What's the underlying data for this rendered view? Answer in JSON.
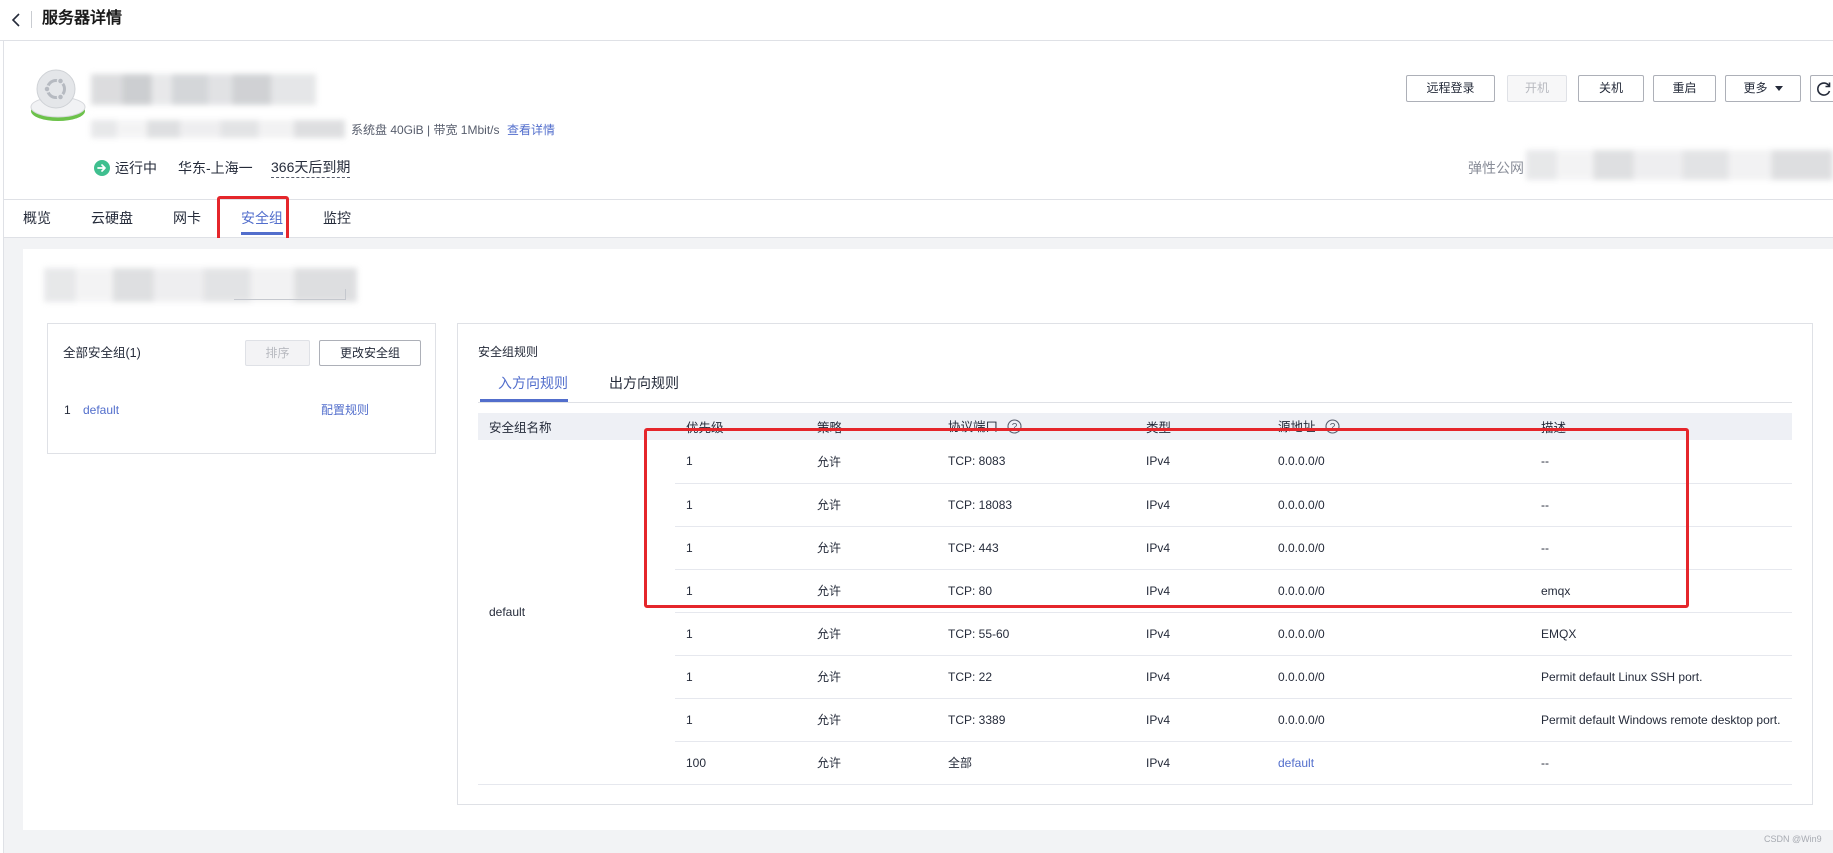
{
  "header": {
    "title": "服务器详情"
  },
  "server": {
    "specs": "系统盘 40GiB | 带宽 1Mbit/s",
    "details_link": "查看详情",
    "status": "运行中",
    "region": "华东-上海一",
    "expiry": "366天后到期",
    "eip_label": "弹性公网"
  },
  "actions": {
    "remote_login": "远程登录",
    "power_on": "开机",
    "power_off": "关机",
    "restart": "重启",
    "more": "更多"
  },
  "tabs": {
    "items": [
      "概览",
      "云硬盘",
      "网卡",
      "安全组",
      "监控"
    ],
    "active_index": 3
  },
  "security_groups": {
    "title": "全部安全组(1)",
    "sort_button": "排序",
    "change_button": "更改安全组",
    "items": [
      {
        "index": "1",
        "name": "default",
        "action": "配置规则"
      }
    ]
  },
  "rules": {
    "title": "安全组规则",
    "tabs": [
      "入方向规则",
      "出方向规则"
    ],
    "active_tab_index": 0,
    "columns": [
      "安全组名称",
      "优先级",
      "策略",
      "协议端口",
      "类型",
      "源地址",
      "描述"
    ],
    "group_name": "default",
    "rows": [
      {
        "priority": "1",
        "policy": "允许",
        "port": "TCP: 8083",
        "type": "IPv4",
        "source": "0.0.0.0/0",
        "description": "--"
      },
      {
        "priority": "1",
        "policy": "允许",
        "port": "TCP: 18083",
        "type": "IPv4",
        "source": "0.0.0.0/0",
        "description": "--"
      },
      {
        "priority": "1",
        "policy": "允许",
        "port": "TCP: 443",
        "type": "IPv4",
        "source": "0.0.0.0/0",
        "description": "--"
      },
      {
        "priority": "1",
        "policy": "允许",
        "port": "TCP: 80",
        "type": "IPv4",
        "source": "0.0.0.0/0",
        "description": "emqx"
      },
      {
        "priority": "1",
        "policy": "允许",
        "port": "TCP: 55-60",
        "type": "IPv4",
        "source": "0.0.0.0/0",
        "description": "EMQX"
      },
      {
        "priority": "1",
        "policy": "允许",
        "port": "TCP: 22",
        "type": "IPv4",
        "source": "0.0.0.0/0",
        "description": "Permit default Linux SSH port."
      },
      {
        "priority": "1",
        "policy": "允许",
        "port": "TCP: 3389",
        "type": "IPv4",
        "source": "0.0.0.0/0",
        "description": "Permit default Windows remote desktop port."
      },
      {
        "priority": "100",
        "policy": "允许",
        "port": "全部",
        "type": "IPv4",
        "source": "default",
        "description": "--",
        "source_is_link": true
      }
    ]
  },
  "watermark": "CSDN @Win9",
  "icons": {
    "back": "chevron-left-icon",
    "os": "ubuntu-os-icon",
    "status": "running-status-icon",
    "more": "chevron-down-icon",
    "refresh": "refresh-icon",
    "help": "help-icon"
  },
  "colors": {
    "accent": "#526ecc",
    "highlight_box": "#e5262b",
    "status_running": "#3fbf8f",
    "page_background": "#f2f3f5",
    "table_header": "#eef0f5"
  }
}
